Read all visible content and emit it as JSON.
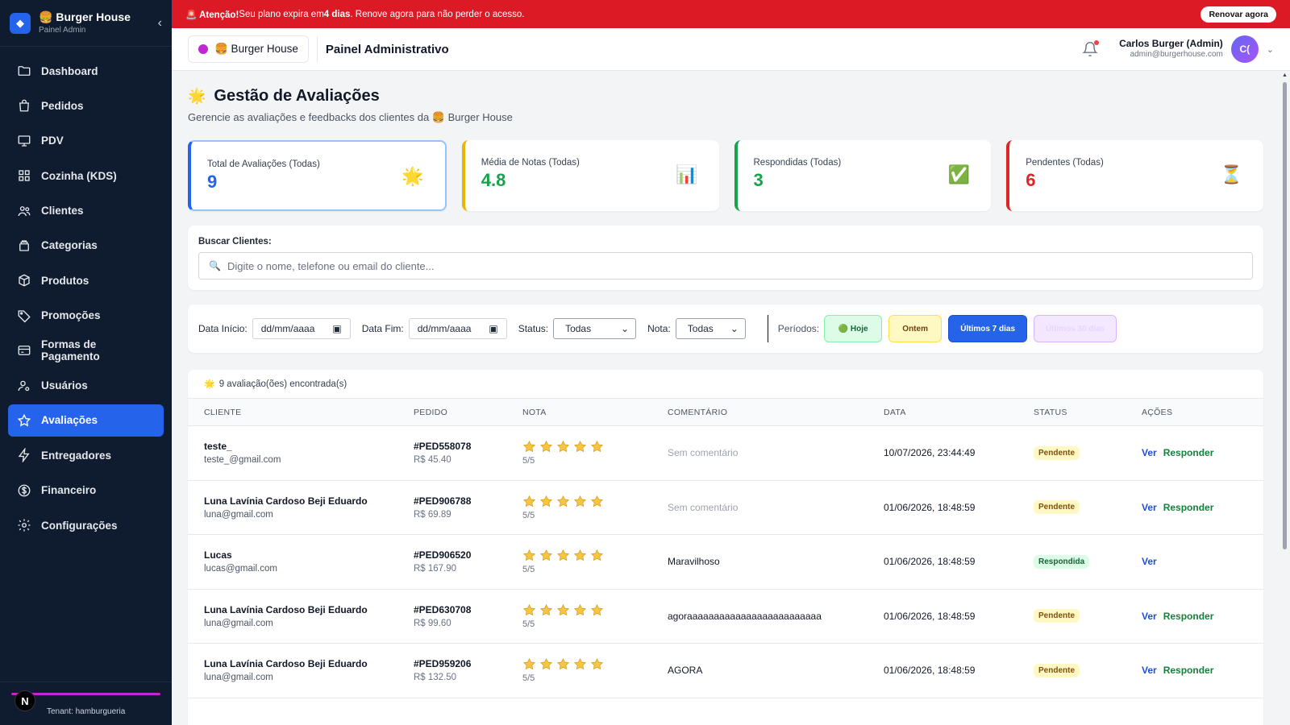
{
  "brand": {
    "emoji": "🍔",
    "name": "Burger House",
    "subtitle": "Painel Admin"
  },
  "sidebar": {
    "items": [
      {
        "label": "Dashboard",
        "icon": "folder-icon"
      },
      {
        "label": "Pedidos",
        "icon": "bag-icon"
      },
      {
        "label": "PDV",
        "icon": "monitor-icon"
      },
      {
        "label": "Cozinha (KDS)",
        "icon": "grid-icon"
      },
      {
        "label": "Clientes",
        "icon": "users-icon"
      },
      {
        "label": "Categorias",
        "icon": "layers-icon"
      },
      {
        "label": "Produtos",
        "icon": "box-icon"
      },
      {
        "label": "Promoções",
        "icon": "tag-icon"
      },
      {
        "label": "Formas de Pagamento",
        "icon": "card-icon"
      },
      {
        "label": "Usuários",
        "icon": "user-gear-icon"
      },
      {
        "label": "Avaliações",
        "icon": "star-icon",
        "active": true
      },
      {
        "label": "Entregadores",
        "icon": "bolt-icon"
      },
      {
        "label": "Financeiro",
        "icon": "dollar-icon"
      },
      {
        "label": "Configurações",
        "icon": "gear-icon"
      }
    ],
    "footer_avatar": "N",
    "tenant": "Tenant: hamburgueria"
  },
  "banner": {
    "prefix": "🚨 Atenção!",
    "text_a": " Seu plano expira em ",
    "days": "4 dias",
    "text_b": ". Renove agora para não perder o acesso.",
    "button": "Renovar agora"
  },
  "header": {
    "store": "🍔 Burger House",
    "title": "Painel Administrativo",
    "user_name": "Carlos Burger (Admin)",
    "user_email": "admin@burgerhouse.com",
    "avatar": "C("
  },
  "page": {
    "icon": "🌟",
    "title": "Gestão de Avaliações",
    "subtitle": "Gerencie as avaliações e feedbacks dos clientes da 🍔 Burger House"
  },
  "stats": [
    {
      "label": "Total de Avaliações (Todas)",
      "value": "9",
      "icon": "🌟",
      "color": "#2563eb"
    },
    {
      "label": "Média de Notas (Todas)",
      "value": "4.8",
      "icon": "📊",
      "color": "#16a34a"
    },
    {
      "label": "Respondidas (Todas)",
      "value": "3",
      "icon": "✅",
      "color": "#16a34a"
    },
    {
      "label": "Pendentes (Todas)",
      "value": "6",
      "icon": "⏳",
      "color": "#dc2626"
    }
  ],
  "search": {
    "label": "Buscar Clientes:",
    "placeholder": "Digite o nome, telefone ou email do cliente..."
  },
  "filters": {
    "start_label": "Data Início:",
    "start_value": "dd/mm/aaaa",
    "end_label": "Data Fim:",
    "end_value": "dd/mm/aaaa",
    "status_label": "Status:",
    "status_value": "Todas",
    "nota_label": "Nota:",
    "nota_value": "Todas",
    "periods_label": "Períodos:",
    "periods": [
      "🟢 Hoje",
      "Ontem",
      "Últimos 7 dias",
      "Últimos 30 dias"
    ]
  },
  "table": {
    "found": "9 avaliação(ões) encontrada(s)",
    "found_icon": "🌟",
    "headers": [
      "CLIENTE",
      "PEDIDO",
      "NOTA",
      "COMENTÁRIO",
      "DATA",
      "STATUS",
      "AÇÕES"
    ],
    "rows": [
      {
        "name": "teste_",
        "email": "teste_@gmail.com",
        "order": "#PED558078",
        "value": "R$ 45.40",
        "rating": 5,
        "score": "5/5",
        "comment": "Sem comentário",
        "no_comment": true,
        "date": "10/07/2026, 23:44:49",
        "status": "Pendente",
        "actions": [
          "Ver",
          "Responder"
        ]
      },
      {
        "name": "Luna Lavínia Cardoso Beji Eduardo",
        "email": "luna@gmail.com",
        "order": "#PED906788",
        "value": "R$ 69.89",
        "rating": 5,
        "score": "5/5",
        "comment": "Sem comentário",
        "no_comment": true,
        "date": "01/06/2026, 18:48:59",
        "status": "Pendente",
        "actions": [
          "Ver",
          "Responder"
        ]
      },
      {
        "name": "Lucas",
        "email": "lucas@gmail.com",
        "order": "#PED906520",
        "value": "R$ 167.90",
        "rating": 5,
        "score": "5/5",
        "comment": "Maravilhoso",
        "no_comment": false,
        "date": "01/06/2026, 18:48:59",
        "status": "Respondida",
        "actions": [
          "Ver"
        ]
      },
      {
        "name": "Luna Lavínia Cardoso Beji Eduardo",
        "email": "luna@gmail.com",
        "order": "#PED630708",
        "value": "R$ 99.60",
        "rating": 5,
        "score": "5/5",
        "comment": "agoraaaaaaaaaaaaaaaaaaaaaaaaa",
        "no_comment": false,
        "date": "01/06/2026, 18:48:59",
        "status": "Pendente",
        "actions": [
          "Ver",
          "Responder"
        ]
      },
      {
        "name": "Luna Lavínia Cardoso Beji Eduardo",
        "email": "luna@gmail.com",
        "order": "#PED959206",
        "value": "R$ 132.50",
        "rating": 5,
        "score": "5/5",
        "comment": "AGORA",
        "no_comment": false,
        "date": "01/06/2026, 18:48:59",
        "status": "Pendente",
        "actions": [
          "Ver",
          "Responder"
        ]
      }
    ]
  }
}
